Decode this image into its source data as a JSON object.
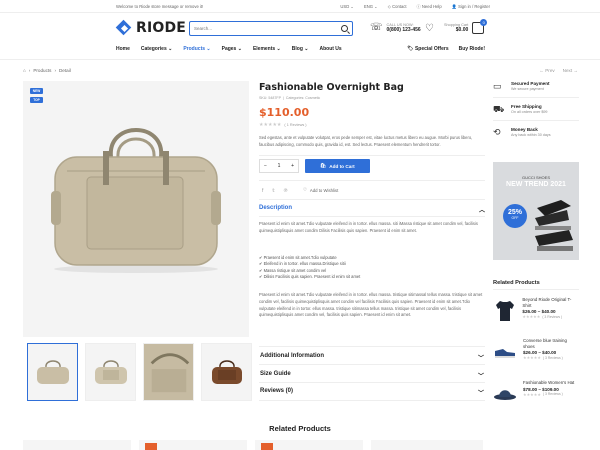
{
  "topbar": {
    "welcome": "Welcome to Riode store message or remove it!",
    "currency": "USD",
    "language": "ENG",
    "contact": "Contact",
    "help": "Need Help",
    "login": "Sign in",
    "separator": "/",
    "register": "Register"
  },
  "brand": {
    "name": "RIODE",
    "accent": "#2f6fd8"
  },
  "search": {
    "placeholder": "Search..."
  },
  "call": {
    "label": "CALL US NOW:",
    "number": "0(800) 123-456"
  },
  "cart": {
    "label": "Shopping Cart",
    "amount": "$0.00",
    "count": "0"
  },
  "nav": {
    "items": [
      "Home",
      "Categories",
      "Products",
      "Pages",
      "Elements",
      "Blog",
      "About Us"
    ],
    "special_offers": "Special Offers",
    "buy": "Buy Riode!"
  },
  "breadcrumb": {
    "home_icon": "home-icon",
    "products": "Products",
    "current": "Detail"
  },
  "pager": {
    "prev": "Prev",
    "next": "Next"
  },
  "gallery": {
    "badge_new": "NEW",
    "badge_top": "TOP"
  },
  "product": {
    "title": "Fashionable Overnight Bag",
    "sku": "SKU: 5487FP",
    "brand": "Categories: Cosmetic",
    "price": "$110.00",
    "stars": "★★★★★",
    "reviews": "( 1 Reviews )",
    "short_desc": "Sed egestas, ante et vulputate volutpat, eros pede semper est, vitae luctus metus libero eu augue. Morbi purus libero, faucibus adipiscing, commodo quis, gravida id, est. Sed lectus. Praesent elementum hendrerit tortor.",
    "qty": "1",
    "qty_minus": "−",
    "qty_plus": "+",
    "add_to_cart": "Add to Cart",
    "wishlist": "Add to Wishlist",
    "price_color": "#e45f2b"
  },
  "description": {
    "heading": "Description",
    "para1": "Praesent id enim sit amet.Tdio vulputate eleifend in in tortor. ellus massa. siti iMassa ristique sit amet condim vel, facilisis quimequistiplisquis amet condim Dilisis Facilisis quis sapien. Praesent id enim sit amet.",
    "checks": [
      "Praesent id enim sit amet.Tdio vulputate",
      "Eleifend in in tortor. ellus massa.Dristique sitii",
      "Massa ristique sit amet condim vel",
      "Dilisis Facilisis quis sapien. Praesent id enim sit amet"
    ],
    "para2": "Praesent id enim sit amet.Tdio vulputate eleifend in in tortor. ellus massa. tristique sitimassal tellus massa. tristique sit amet condim vel, facilisis quimequistiplisquis amet condim vel facilisis Facilisis quis sapien. Praesent id enim sit amet.Tdio vulputate eleifend in in tortor. ellus massa. tristique sitimassa tellus massa. tristique sit amet condim vel, facilisis quimequistiplisquis amet condim vel, facilisis quis sapien. Praesent id enim sit amet."
  },
  "accordion": {
    "additional": "Additional Information",
    "size": "Size Guide",
    "reviews": "Reviews (0)"
  },
  "sidebar": {
    "features": [
      {
        "icon": "payment-icon",
        "title": "Secured Payment",
        "sub": "We secure payment"
      },
      {
        "icon": "truck-icon",
        "title": "Free Shipping",
        "sub": "On all orders over $99"
      },
      {
        "icon": "money-back-icon",
        "title": "Money Back",
        "sub": "Any back within 30 days"
      }
    ],
    "banner": {
      "subtitle": "GUCCI SHOES",
      "title": "NEW TREND 2021",
      "discount": "25%",
      "off": "OFF"
    },
    "related_heading": "Related Products",
    "related": [
      {
        "name": "Beyond Riode Original T-Shirt",
        "price": "$26.00 – $40.00",
        "stars": "★★★★★",
        "count": "( 3 Reviews )"
      },
      {
        "name": "Converse blue training shoes",
        "price": "$26.00 – $40.00",
        "stars": "★★★★★",
        "count": "( 3 Reviews )"
      },
      {
        "name": "Fashionable Women's Hat",
        "price": "$78.00 – $109.00",
        "stars": "★★★★★",
        "count": "( 3 Reviews )"
      }
    ]
  },
  "bottom": {
    "heading": "Related Products"
  }
}
